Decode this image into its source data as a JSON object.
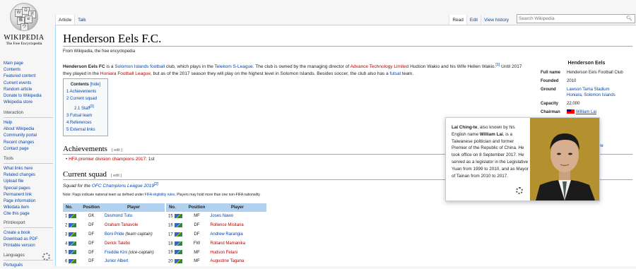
{
  "logo": {
    "wordmark": "WIKIPEDIA",
    "tagline": "The Free Encyclopedia"
  },
  "nav": {
    "main": [
      "Main page",
      "Contents",
      "Featured content",
      "Current events",
      "Random article",
      "Donate to Wikipedia",
      "Wikipedia store"
    ],
    "interaction_title": "Interaction",
    "interaction": [
      "Help",
      "About Wikipedia",
      "Community portal",
      "Recent changes",
      "Contact page"
    ],
    "tools_title": "Tools",
    "tools": [
      "What links here",
      "Related changes",
      "Upload file",
      "Special pages",
      "Permanent link",
      "Page information",
      "Wikidata item",
      "Cite this page"
    ],
    "print_title": "Print/export",
    "print": [
      "Create a book",
      "Download as PDF",
      "Printable version"
    ],
    "languages_title": "Languages",
    "languages_first": "Português"
  },
  "tabs": {
    "article": "Article",
    "talk": "Talk",
    "read": "Read",
    "edit": "Edit",
    "history": "View history"
  },
  "search": {
    "placeholder": "Search Wikipedia"
  },
  "page": {
    "title": "Henderson Eels F.C.",
    "from": "From Wikipedia, the free encyclopedia",
    "intro": {
      "name": "Henderson Eels FC",
      "t1": " is a ",
      "l1": "Solomon Islands",
      "t2": " ",
      "l2": "football",
      "t3": " club, which plays in the ",
      "l3": "Telekom S-League",
      "t4": ". The club is owned by the managing director of ",
      "l4": "Advance Technology Limited",
      "t5": " Hudson Wakio and his Wife Hellen Wakio.",
      "ref1": "[1]",
      "t6": " Until 2017 they played in the ",
      "l5": "Honiara Football League",
      "t7": ", but as of the 2017 season they will play on the highest level in Solomon Islands. Besides soccer, the club also has a ",
      "l6": "futsal",
      "t8": " team."
    },
    "toc": {
      "title": "Contents",
      "hide": "[hide]",
      "items": [
        "1 Achievements",
        "2 Current squad",
        "2.1 Staff",
        "3 Futsal team",
        "4 References",
        "5 External links"
      ],
      "staff_ref": "[3]"
    },
    "achievements": {
      "heading": "Achievements",
      "edit": "[ edit ]",
      "item_link": "HFA premier division champions 2017",
      "item_text": ": 1st"
    },
    "squad": {
      "heading": "Current squad",
      "edit": "[ edit ]",
      "line_text": "Squad for the ",
      "line_link": "OFC Champions League 2019",
      "line_ref": "[2]",
      "note_a": "Note: Flags indicate national team as defined under ",
      "note_link": "FIFA eligibility rules",
      "note_b": ". Players may hold more than one non-FIFA nationality.",
      "headers": [
        "No.",
        "Position",
        "Player"
      ],
      "left": [
        {
          "no": "1",
          "pos": "GK",
          "player": "Desmond Tutu",
          "red": false,
          "extra": ""
        },
        {
          "no": "2",
          "pos": "DF",
          "player": "Graham Tanavole",
          "red": true,
          "extra": ""
        },
        {
          "no": "3",
          "pos": "DF",
          "player": "Boni Pride",
          "red": false,
          "extra": " (team captain)"
        },
        {
          "no": "4",
          "pos": "DF",
          "player": "Derick Talebo",
          "red": true,
          "extra": ""
        },
        {
          "no": "5",
          "pos": "DF",
          "player": "Freddie Kini",
          "red": false,
          "extra": " (vice-captain)"
        },
        {
          "no": "6",
          "pos": "DF",
          "player": "Junior Albert",
          "red": false,
          "extra": ""
        }
      ],
      "right": [
        {
          "no": "15",
          "pos": "MF",
          "player": "Joses Nawo",
          "red": false,
          "extra": ""
        },
        {
          "no": "16",
          "pos": "DF",
          "player": "Rollence Misitana",
          "red": true,
          "extra": ""
        },
        {
          "no": "17",
          "pos": "DF",
          "player": "Andrew Rarangia",
          "red": false,
          "extra": ""
        },
        {
          "no": "18",
          "pos": "FW",
          "player": "Rolland Mamanika",
          "red": true,
          "extra": ""
        },
        {
          "no": "19",
          "pos": "MF",
          "player": "Hudson Felani",
          "red": true,
          "extra": ""
        },
        {
          "no": "20",
          "pos": "MF",
          "player": "Augustine Tagana",
          "red": true,
          "extra": ""
        }
      ]
    }
  },
  "infobox": {
    "title": "Henderson Eels",
    "rows": [
      {
        "label": "Full name",
        "value": "Henderson Eels Football Club"
      },
      {
        "label": "Founded",
        "value": "2010"
      },
      {
        "label": "Ground",
        "value": "Lawson Tama Stadium\nHoniara, Solomon Islands"
      },
      {
        "label": "Capacity",
        "value": "22,000"
      },
      {
        "label": "Chairman",
        "value": "William Lai"
      }
    ],
    "partial": "are"
  },
  "popup": {
    "name": "Lai Ching-te",
    "t1": ", also known by his English name ",
    "english": "William Lai",
    "t2": ", is a Taiwanese politician and former Premier of the Republic of China. He took office on 8 September 2017. He served as a legislator in the Legislative Yuan from 1999 to 2010, and as Mayor of Tainan from 2010 to 2017."
  }
}
